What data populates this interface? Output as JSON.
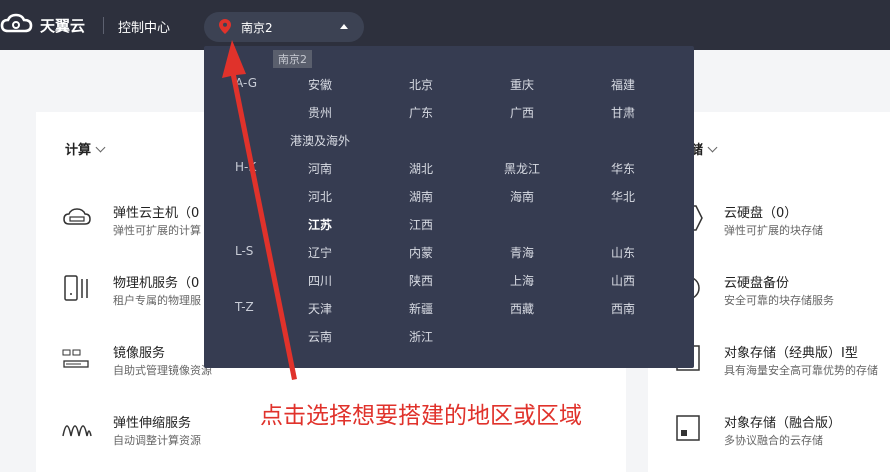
{
  "topbar": {
    "brand": "天翼云",
    "console": "控制中心",
    "region": "南京2",
    "tooltip": "南京2"
  },
  "dropdown": {
    "groups": [
      {
        "label": "A-G",
        "cities": [
          "安徽",
          "北京",
          "重庆",
          "福建",
          "贵州",
          "广东",
          "广西",
          "甘肃",
          "港澳及海外"
        ]
      },
      {
        "label": "H-K",
        "cities": [
          "河南",
          "湖北",
          "黑龙江",
          "华东",
          "河北",
          "湖南",
          "海南",
          "华北",
          "江苏",
          "江西"
        ]
      },
      {
        "label": "L-S",
        "cities": [
          "辽宁",
          "内蒙",
          "青海",
          "山东",
          "四川",
          "陕西",
          "上海",
          "山西"
        ]
      },
      {
        "label": "T-Z",
        "cities": [
          "天津",
          "新疆",
          "西藏",
          "西南",
          "云南",
          "浙江"
        ]
      }
    ],
    "selected": "江苏"
  },
  "sections": {
    "compute": "计算",
    "storage": "储"
  },
  "compute_services": [
    {
      "name": "弹性云主机（0",
      "desc": "弹性可扩展的计算"
    },
    {
      "name": "物理机服务（0",
      "desc": "租户专属的物理服"
    },
    {
      "name": "镜像服务",
      "desc": "自助式管理镜像资源"
    },
    {
      "name": "弹性伸缩服务",
      "desc": "自动调整计算资源"
    }
  ],
  "storage_services": [
    {
      "name": "云硬盘（0）",
      "desc": "弹性可扩展的块存储"
    },
    {
      "name": "云硬盘备份",
      "desc": "安全可靠的块存储服务"
    },
    {
      "name": "对象存储（经典版）Ⅰ型",
      "desc": "具有海量安全高可靠优势的存储"
    },
    {
      "name": "对象存储（融合版）",
      "desc": "多协议融合的云存储"
    }
  ],
  "annotation": "点击选择想要搭建的地区或区域",
  "colors": {
    "topbar": "#2d303d",
    "dropdown": "#363c51",
    "annotation": "#e0322b",
    "pin": "#e0322b"
  }
}
